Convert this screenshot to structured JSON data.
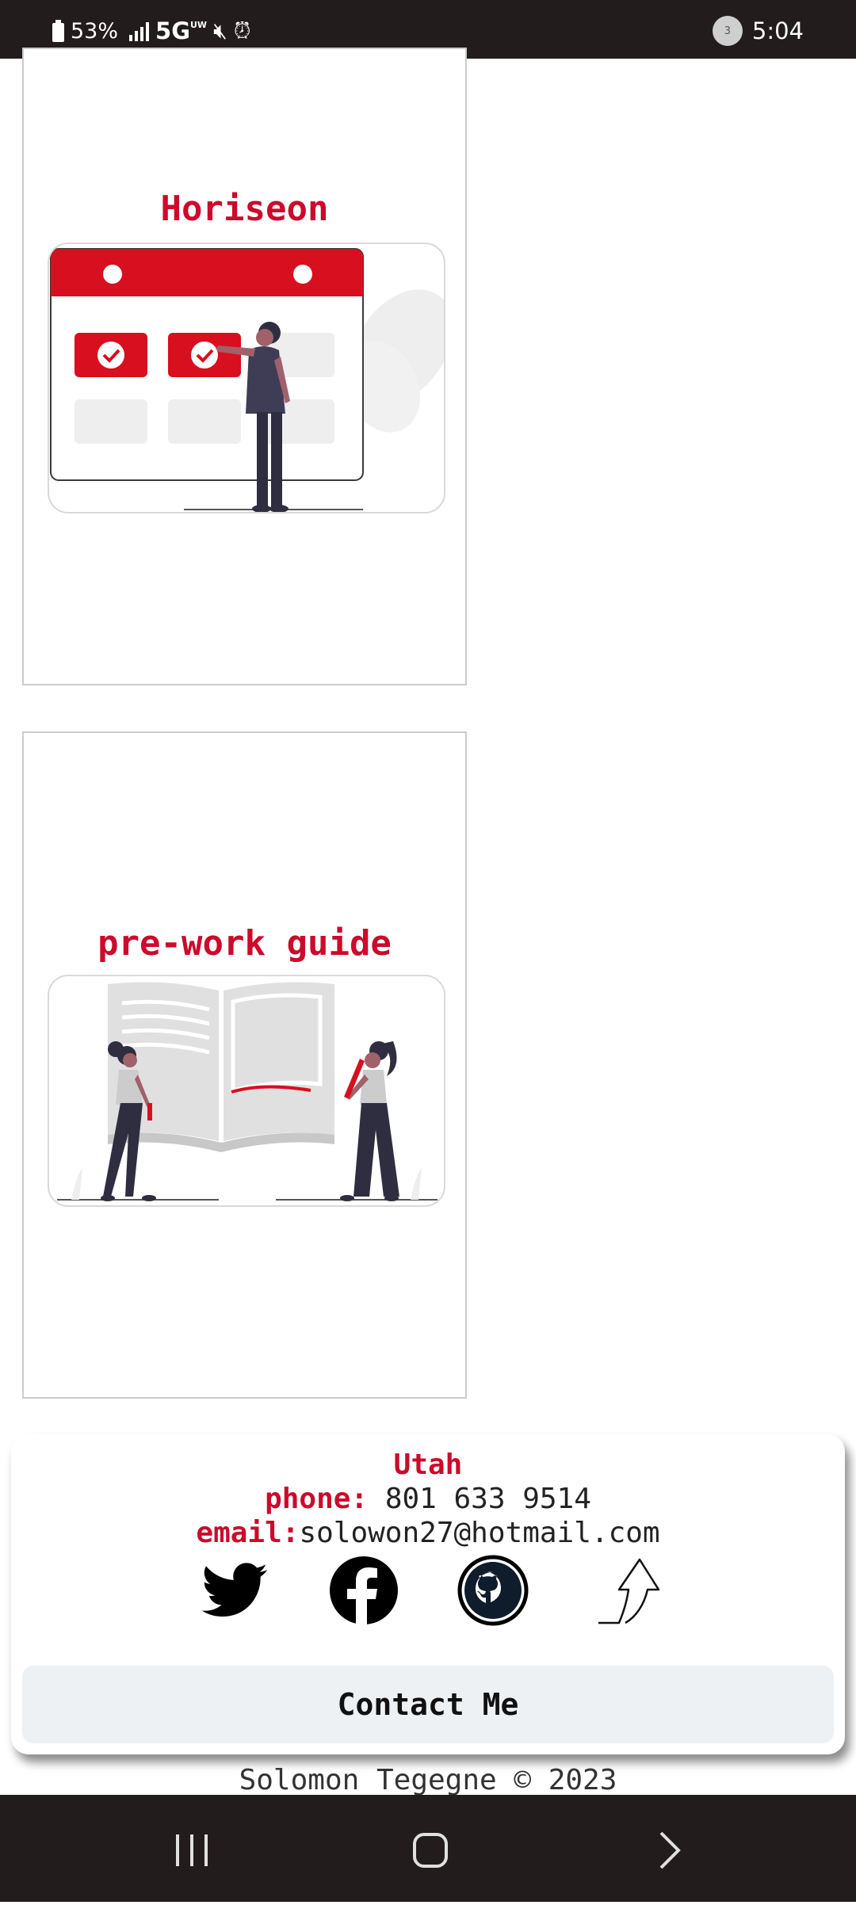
{
  "status_bar": {
    "battery": "53%",
    "network": "5G",
    "network_suffix": "UW",
    "notification_count": "3",
    "time": "5:04"
  },
  "projects": [
    {
      "title": "Horiseon",
      "image": "calendar-illustration"
    },
    {
      "title": "pre-work guide",
      "image": "book-illustration"
    }
  ],
  "contact": {
    "location": "Utah",
    "phone_label": "phone:",
    "phone": "801 633 9514",
    "email_label": "email:",
    "email": "solowon27@hotmail.com",
    "socials": [
      "twitter-icon",
      "facebook-icon",
      "github-icon",
      "back-to-top-icon"
    ],
    "button_label": "Contact Me"
  },
  "footer": {
    "copyright": "Solomon Tegegne © 2023"
  },
  "nav": [
    "recent-apps",
    "home",
    "back"
  ],
  "colors": {
    "accent": "#cc0a2b",
    "status_bar": "#231c1c",
    "button_bg": "#edf1f4"
  }
}
